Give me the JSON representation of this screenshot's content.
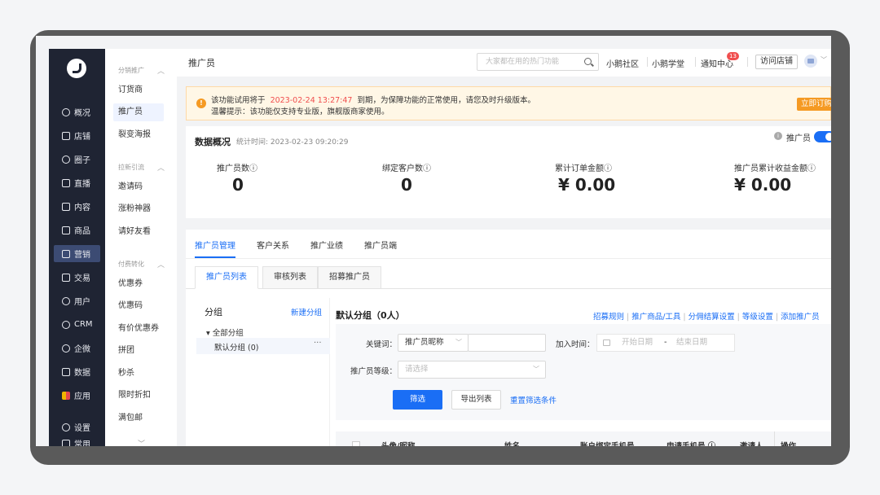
{
  "nav": {
    "items": [
      {
        "label": "概况",
        "icon": "pie-chart-icon"
      },
      {
        "label": "店铺",
        "icon": "store-icon"
      },
      {
        "label": "圈子",
        "icon": "circle-group-icon"
      },
      {
        "label": "直播",
        "icon": "live-icon"
      },
      {
        "label": "内容",
        "icon": "document-icon"
      },
      {
        "label": "商品",
        "icon": "box-icon"
      },
      {
        "label": "营销",
        "icon": "megaphone-icon"
      },
      {
        "label": "交易",
        "icon": "transaction-icon"
      },
      {
        "label": "用户",
        "icon": "user-icon"
      },
      {
        "label": "CRM",
        "icon": "crm-icon"
      },
      {
        "label": "企微",
        "icon": "wecom-icon"
      },
      {
        "label": "数据",
        "icon": "data-icon"
      },
      {
        "label": "应用",
        "icon": "apps-icon"
      },
      {
        "label": "设置",
        "icon": "gear-icon"
      },
      {
        "label": "常用",
        "icon": "list-icon"
      }
    ],
    "active": "营销"
  },
  "sub": {
    "sections": [
      {
        "title": "分销推广",
        "items": [
          "订货商",
          "推广员",
          "裂变海报"
        ]
      },
      {
        "title": "拉新引流",
        "items": [
          "邀请码",
          "涨粉神器",
          "请好友看"
        ]
      },
      {
        "title": "付费转化",
        "items": [
          "优惠券",
          "优惠码",
          "有价优惠券",
          "拼团",
          "秒杀",
          "限时折扣",
          "满包邮"
        ]
      }
    ],
    "active": "推广员",
    "more": "﹀"
  },
  "topbar": {
    "title": "推广员",
    "search_placeholder": "大家都在用的热门功能",
    "links": [
      "小鹅社区",
      "小鹅学堂",
      "通知中心"
    ],
    "notification_count": "13",
    "visit_store": "访问店铺"
  },
  "notice": {
    "line1_prefix": "该功能试用将于",
    "line1_date": "2023-02-24 13:27:47",
    "line1_suffix": "到期，为保障功能的正常使用，请您及时升级版本。",
    "line2": "温馨提示：该功能仅支持专业版，旗舰版商家使用。",
    "button": "立即订购"
  },
  "overview": {
    "title": "数据概况",
    "stat_time": "统计时间: 2023-02-23 09:20:29",
    "role_label": "推广员",
    "stats": [
      {
        "label": "推广员数ⓘ",
        "value": "0"
      },
      {
        "label": "绑定客户数ⓘ",
        "value": "0"
      },
      {
        "label": "累计订单金额ⓘ",
        "value": "¥ 0.00"
      },
      {
        "label": "推广员累计收益金额ⓘ",
        "value": "¥ 0.00"
      }
    ]
  },
  "tabs": [
    "推广员管理",
    "客户关系",
    "推广业绩",
    "推广员端"
  ],
  "subtabs": [
    "推广员列表",
    "审核列表",
    "招募推广员"
  ],
  "groups": {
    "title": "分组",
    "new": "新建分组",
    "all": "▾ 全部分组",
    "default": "默认分组 (0)",
    "dots": "···"
  },
  "list": {
    "title": "默认分组（0人）",
    "actions": [
      "招募规则",
      "推广商品/工具",
      "分佣结算设置",
      "等级设置",
      "添加推广员"
    ]
  },
  "filter": {
    "keyword_label": "关键词：",
    "keyword_type": "推广员昵称",
    "join_label": "加入时间：",
    "start_placeholder": "开始日期",
    "end_placeholder": "结束日期",
    "dash": "-",
    "level_label": "推广员等级：",
    "level_placeholder": "请选择",
    "btn_filter": "筛选",
    "btn_export": "导出列表",
    "btn_reset": "重置筛选条件"
  },
  "table": {
    "columns": [
      "头像/昵称",
      "姓名",
      "账户绑定手机号",
      "申请手机号 ⓘ",
      "邀请人",
      "操作"
    ]
  }
}
